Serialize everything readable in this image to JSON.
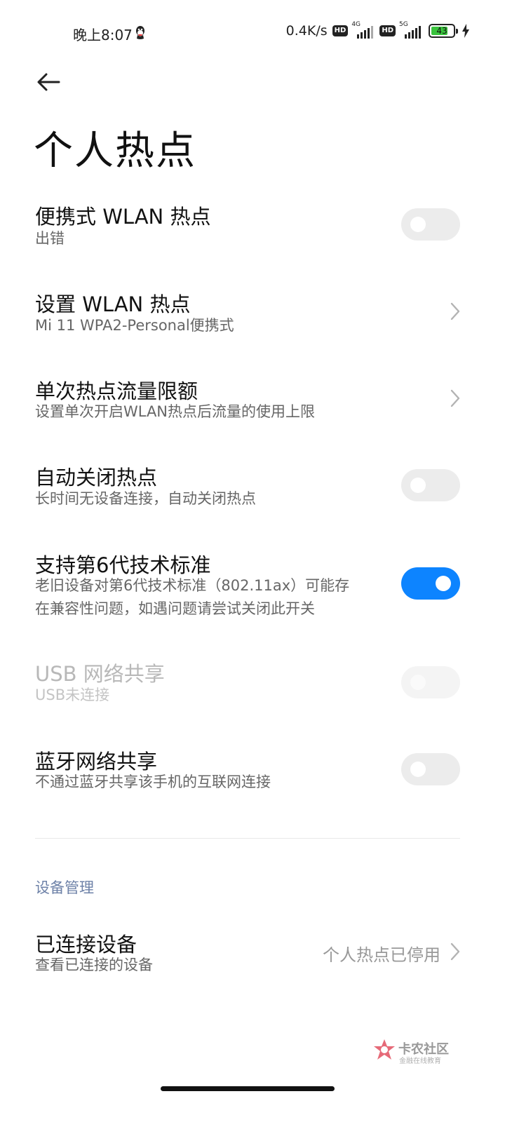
{
  "status_bar": {
    "time": "晚上8:07",
    "qq_icon": "qq-penguin-icon",
    "net_speed": "0.4K/s",
    "hd1": "HD",
    "sim1_type": "4G",
    "hd2": "HD",
    "sim2_type": "5G",
    "battery_level": "43",
    "charging": true,
    "battery_color": "#39c23c"
  },
  "header": {
    "back_icon": "arrow-left-icon",
    "title": "个人热点"
  },
  "settings": {
    "portable_hotspot": {
      "title": "便携式 WLAN 热点",
      "subtitle": "出错",
      "enabled": false
    },
    "setup_hotspot": {
      "title": "设置 WLAN 热点",
      "subtitle": "Mi 11 WPA2-Personal便携式"
    },
    "data_limit": {
      "title": "单次热点流量限额",
      "subtitle": "设置单次开启WLAN热点后流量的使用上限"
    },
    "auto_close": {
      "title": "自动关闭热点",
      "subtitle": "长时间无设备连接，自动关闭热点",
      "enabled": false
    },
    "wifi6": {
      "title": "支持第6代技术标准",
      "subtitle_line1": "老旧设备对第6代技术标准（802.11ax）可能存",
      "subtitle_line2": "在兼容性问题，如遇问题请尝试关闭此开关",
      "enabled": true
    },
    "usb_tethering": {
      "title": "USB 网络共享",
      "subtitle": "USB未连接",
      "enabled": false,
      "disabled": true
    },
    "bluetooth_tethering": {
      "title": "蓝牙网络共享",
      "subtitle": "不通过蓝牙共享该手机的互联网连接",
      "enabled": false
    }
  },
  "device_management": {
    "section_title": "设备管理",
    "connected_devices": {
      "title": "已连接设备",
      "subtitle": "查看已连接的设备",
      "value": "个人热点已停用"
    }
  },
  "watermark": {
    "title": "卡农社区",
    "subtitle": "金融在线教育"
  },
  "colors": {
    "accent": "#0d84ff",
    "section_header": "#6e82a8",
    "toggle_off": "#ececec"
  }
}
